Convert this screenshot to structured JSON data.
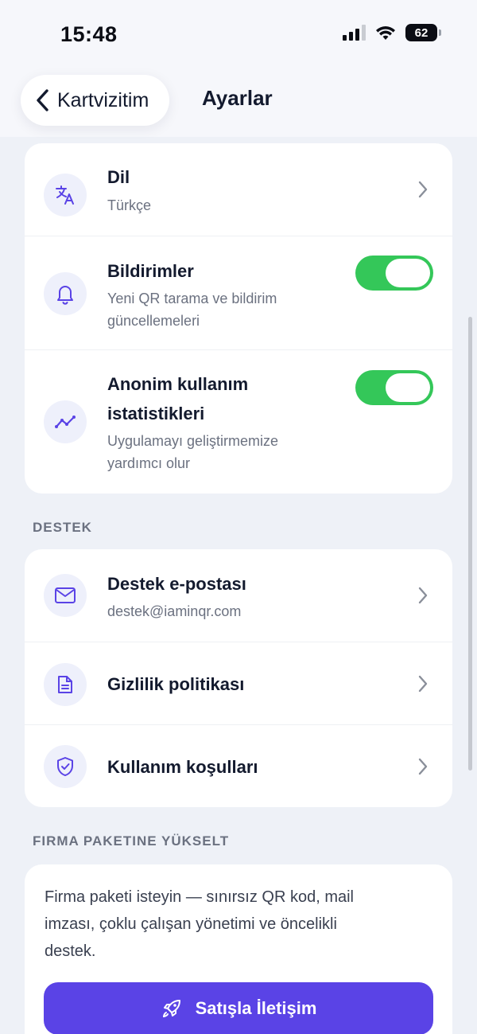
{
  "status_bar": {
    "time": "15:48",
    "battery": "62"
  },
  "header": {
    "back_label": "Kartvizitim",
    "title": "Ayarlar"
  },
  "general": {
    "language": {
      "title": "Dil",
      "value": "Türkçe"
    },
    "notifications": {
      "title": "Bildirimler",
      "subtitle_1": "Yeni QR tarama ve bildirim",
      "subtitle_2": "güncellemeleri",
      "enabled": true
    },
    "analytics": {
      "title_1": "Anonim kullanım",
      "title_2": "istatistikleri",
      "subtitle_1": "Uygulamayı geliştirmemize",
      "subtitle_2": "yardımcı olur",
      "enabled": true
    }
  },
  "support": {
    "section_label": "DESTEK",
    "email": {
      "title": "Destek e-postası",
      "value": "destek@iaminqr.com"
    },
    "privacy": {
      "title": "Gizlilik politikası"
    },
    "terms": {
      "title": "Kullanım koşulları"
    }
  },
  "upgrade": {
    "section_label": "FIRMA PAKETINE YÜKSELT",
    "text_1": "Firma paketi isteyin — sınırsız QR kod, mail",
    "text_2": "imzası, çoklu çalışan yönetimi ve öncelikli",
    "text_3": "destek.",
    "button_label": "Satışla İletişim"
  },
  "colors": {
    "accent": "#5a43e6",
    "toggle_on": "#34c759",
    "icon_bg": "#eef0fb",
    "icon": "#5a43e6"
  }
}
